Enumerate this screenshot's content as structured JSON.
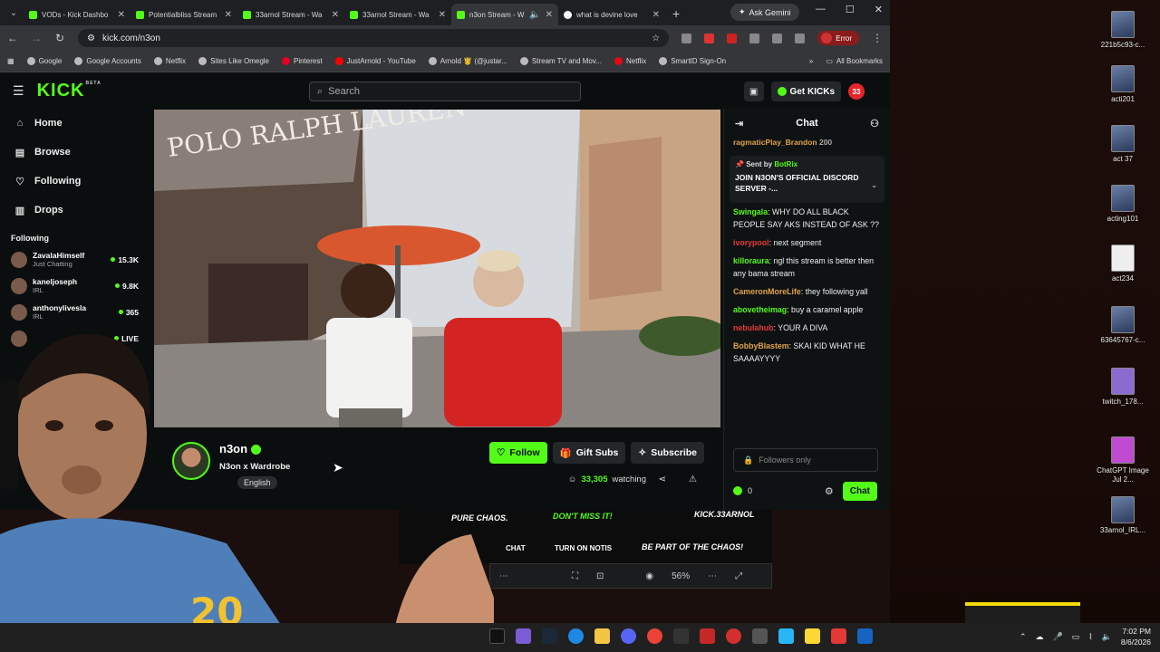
{
  "browser": {
    "tabs": [
      {
        "title": "VODs - Kick Dashbo",
        "active": false
      },
      {
        "title": "Potentialbliss Stream",
        "active": false
      },
      {
        "title": "33arnol Stream - Wa",
        "active": false
      },
      {
        "title": "33arnol Stream - Wa",
        "active": false
      },
      {
        "title": "n3on Stream - W",
        "active": true
      },
      {
        "title": "what is devine love",
        "active": false
      }
    ],
    "ask_gemini": "Ask Gemini",
    "url": "kick.com/n3on",
    "profile_status": "Error",
    "bookmarks": [
      "Google",
      "Google Accounts",
      "Netflix",
      "Sites Like Omegle",
      "Pinterest",
      "JustArnold - YouTube",
      "Arnold 🤴 (@justar...",
      "Stream TV and Mov...",
      "Netflix",
      "SmartID Sign-On"
    ],
    "all_bookmarks": "All Bookmarks"
  },
  "kick": {
    "search_placeholder": "Search",
    "get_kicks": "Get KICKs",
    "notifications": "33",
    "nav": [
      {
        "label": "Home",
        "icon": "home-icon"
      },
      {
        "label": "Browse",
        "icon": "browse-icon"
      },
      {
        "label": "Following",
        "icon": "heart-icon"
      },
      {
        "label": "Drops",
        "icon": "drops-icon"
      }
    ],
    "following_title": "Following",
    "following": [
      {
        "name": "ZavalaHimself",
        "sub": "Just Chatting",
        "count": "15.3K"
      },
      {
        "name": "kaneljoseph",
        "sub": "IRL",
        "count": "9.8K"
      },
      {
        "name": "anthonylivesla",
        "sub": "IRL",
        "count": "365"
      },
      {
        "name": "",
        "sub": "",
        "count": "LIVE"
      }
    ],
    "stream": {
      "name": "n3on",
      "title": "N3on x Wardrobe",
      "tag": "English",
      "follow": "Follow",
      "gift": "Gift Subs",
      "subscribe": "Subscribe",
      "viewers": "33,305",
      "watching": "watching"
    },
    "chat": {
      "title": "Chat",
      "top_user": "ragmaticPlay_Brandon",
      "top_user_count": "200",
      "pinned_by": "Sent by",
      "pinned_bot": "BotRix",
      "pinned_msg": "JOIN N3ON'S OFFICIAL DISCORD SERVER -...",
      "messages": [
        {
          "user": "Swingala",
          "color": "#53fc18",
          "text": "WHY DO ALL BLACK PEOPLE SAY AKS INSTEAD OF ASK ??"
        },
        {
          "user": "ivorypool",
          "color": "#e53935",
          "text": "next segment"
        },
        {
          "user": "killoraura",
          "color": "#53fc18",
          "text": "ngl this stream is better then any bama stream"
        },
        {
          "user": "CameronMoreLife",
          "color": "#e0a34b",
          "text": "they following yall"
        },
        {
          "user": "abovetheimag",
          "color": "#53fc18",
          "text": "buy a caramel apple"
        },
        {
          "user": "nebulahub",
          "color": "#e53935",
          "text": "YOUR A DIVA"
        },
        {
          "user": "BobbyBlastem",
          "color": "#e0a34b",
          "text": "SKAI KID WHAT HE SAAAAYYYY"
        }
      ],
      "followers_only": "Followers only",
      "kicks": "0",
      "send": "Chat"
    }
  },
  "banner": {
    "pure_chaos": "PURE CHAOS.",
    "dont_miss": "DON'T MISS IT!",
    "kick_handle": "KICK.33ARNOL",
    "chat": "CHAT",
    "turn_on": "TURN ON NOTIS",
    "be_part": "BE PART OF THE CHAOS!",
    "zoom": "56%"
  },
  "desktop_icons": [
    "221b5c93-c...",
    "acti201",
    "act 37",
    "acting101",
    "act234",
    "63645767-c...",
    "twitch_178...",
    "ChatGPT Image Jul 2...",
    "33arnol_IRL..."
  ],
  "taskbar": {
    "time": "7:02 PM",
    "date": "8/6/2026"
  }
}
